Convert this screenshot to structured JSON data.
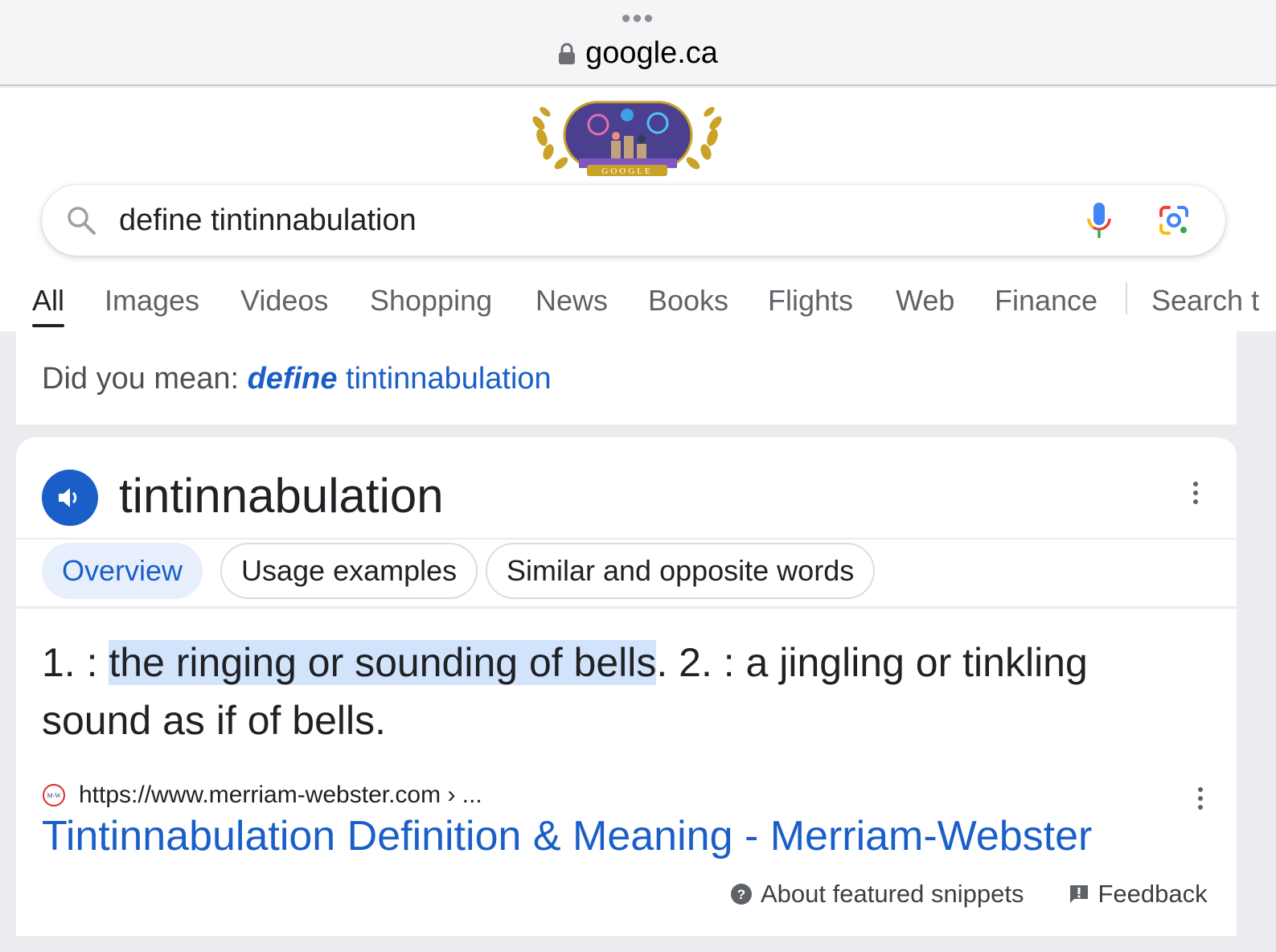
{
  "browser": {
    "url": "google.ca"
  },
  "search": {
    "query": "define tintinnabulation"
  },
  "tabs": [
    {
      "label": "All"
    },
    {
      "label": "Images"
    },
    {
      "label": "Videos"
    },
    {
      "label": "Shopping"
    },
    {
      "label": "News"
    },
    {
      "label": "Books"
    },
    {
      "label": "Flights"
    },
    {
      "label": "Web"
    },
    {
      "label": "Finance"
    },
    {
      "label": "Search t"
    }
  ],
  "did_you_mean": {
    "prefix": "Did you mean:",
    "bold_word": "define",
    "rest": " tintinnabulation"
  },
  "definition": {
    "word": "tintinnabulation",
    "chips": {
      "overview": "Overview",
      "usage": "Usage examples",
      "similar": "Similar and opposite words"
    },
    "text_before": "1. : ",
    "highlighted": "the ringing or sounding of bells",
    "text_after": ". 2. : a jingling or tinkling sound as if of bells.",
    "source_url": "https://www.merriam-webster.com › ...",
    "source_icon_text": "M-W",
    "result_title": "Tintinnabulation Definition & Meaning - Merriam-Webster",
    "about_snippets": "About featured snippets",
    "feedback": "Feedback"
  },
  "doodle_text": "GOOGLE",
  "colors": {
    "link_blue": "#1a5fc8",
    "highlight": "#d2e3fc",
    "chip_active_bg": "#e7effc"
  }
}
